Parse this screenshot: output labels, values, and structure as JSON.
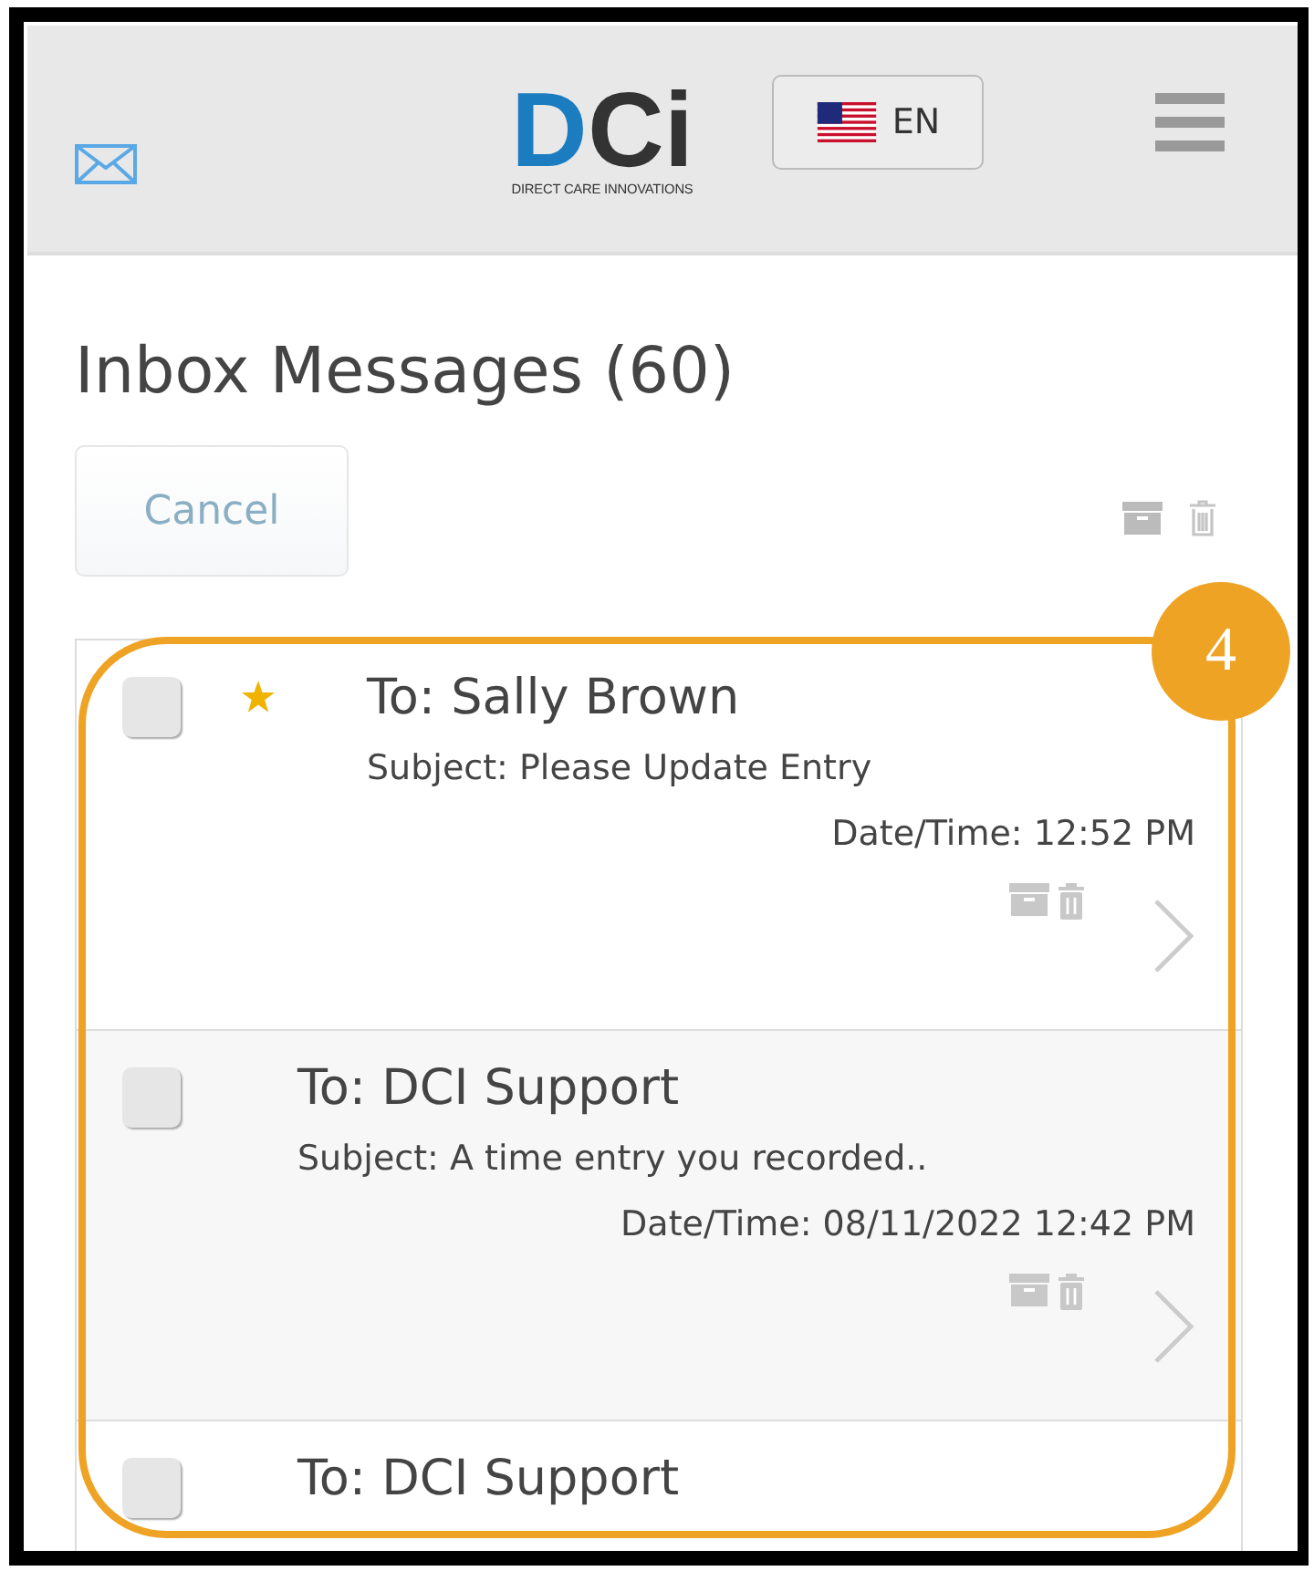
{
  "header": {
    "logo": {
      "mark": "DCi",
      "tagline": "DIRECT CARE INNOVATIONS"
    },
    "language": "EN"
  },
  "title": "Inbox Messages (60)",
  "cancel_button": "Cancel",
  "messages": [
    {
      "to": "To: Sally Brown",
      "subject": "Subject: Please Update Entry",
      "datetime": "Date/Time: 12:52 PM",
      "starred": true,
      "highlighted": false
    },
    {
      "to": "To: DCI Support",
      "subject": "Subject: A time entry you recorded..",
      "datetime": "Date/Time: 08/11/2022 12:42 PM",
      "starred": false,
      "highlighted": true
    },
    {
      "to": "To: DCI Support",
      "starred": false,
      "highlighted": false
    }
  ],
  "annotation": {
    "step": "4"
  }
}
